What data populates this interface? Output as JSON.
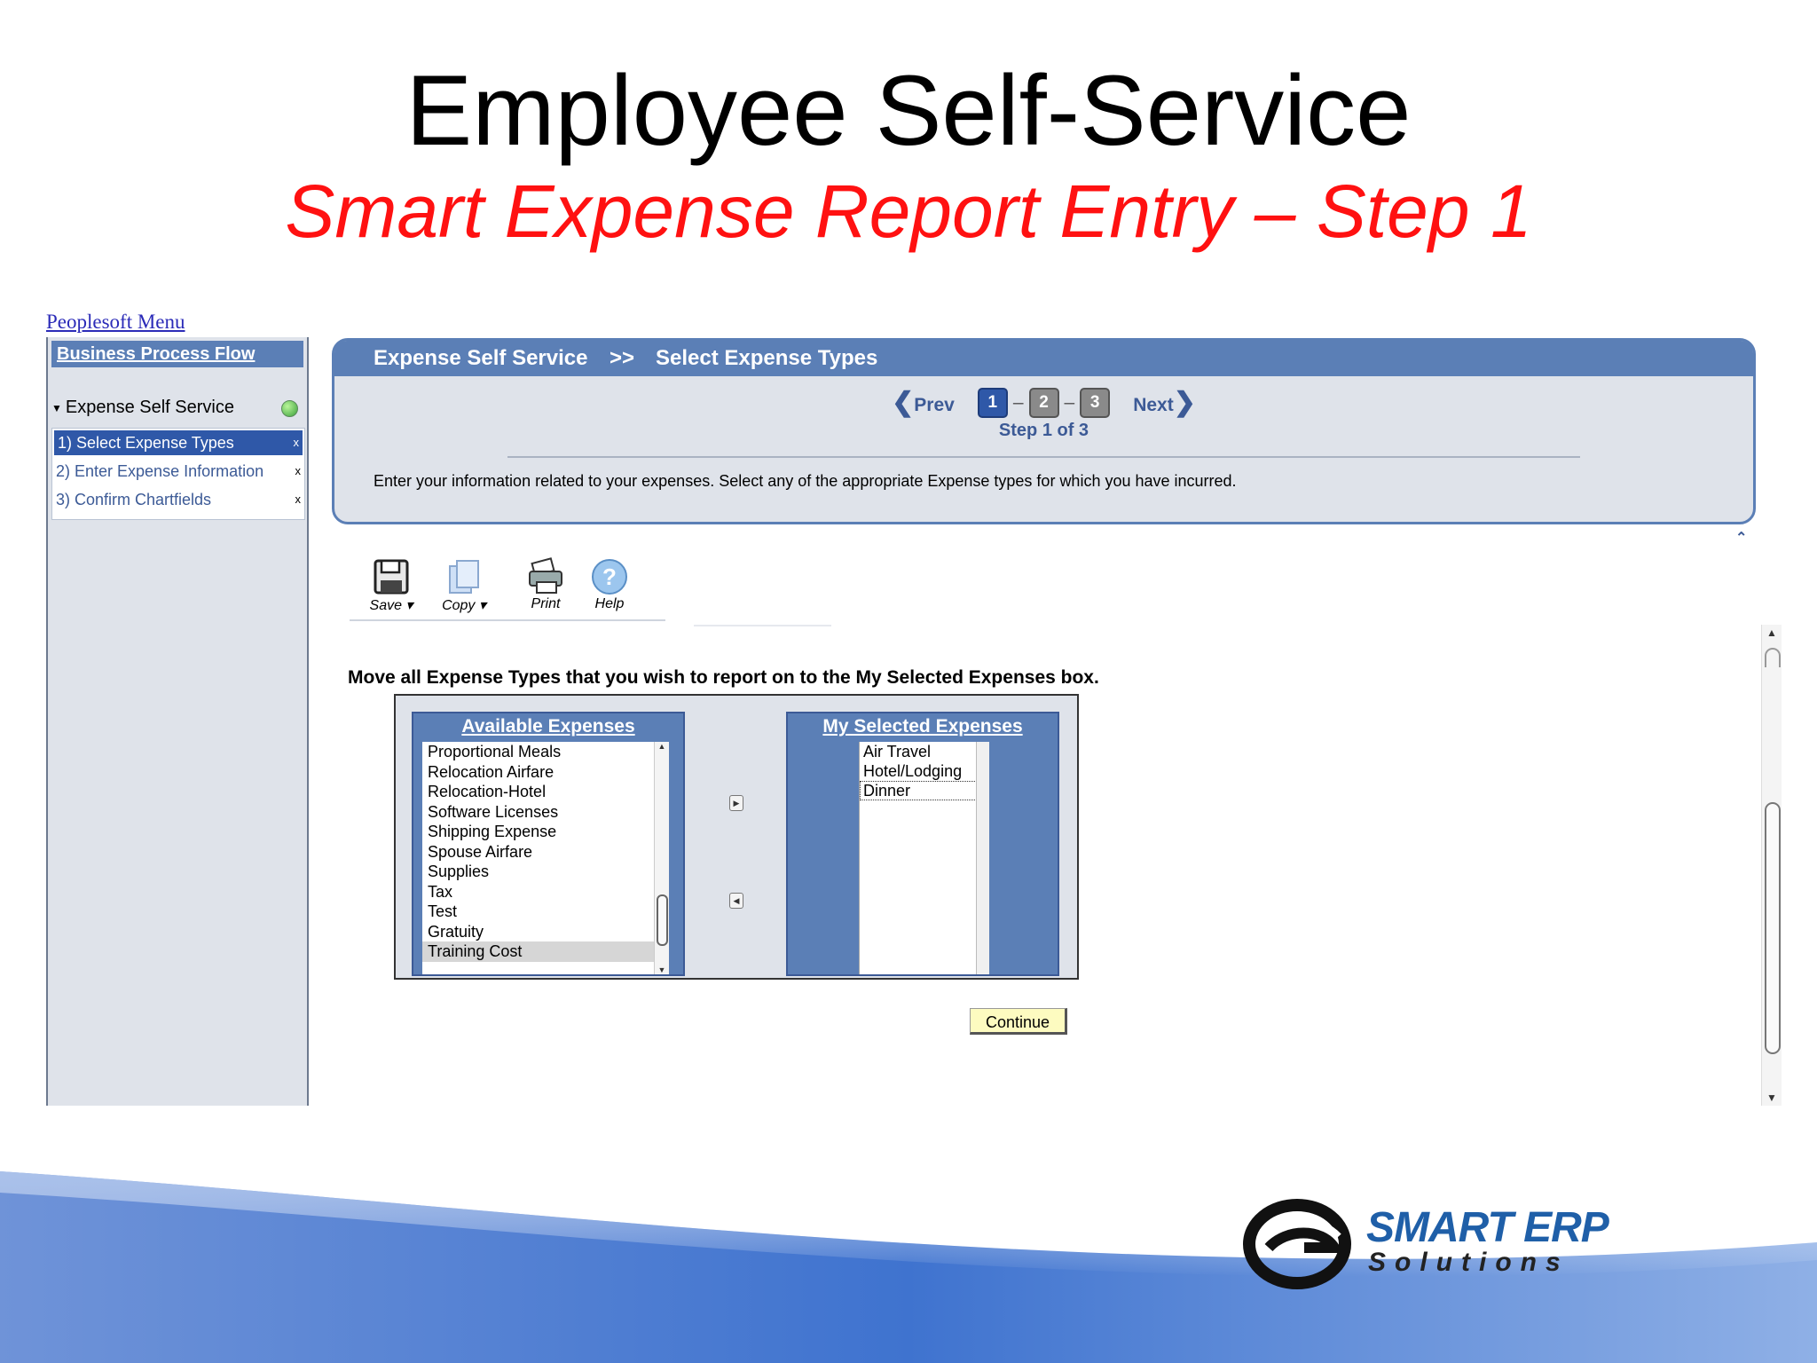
{
  "slide": {
    "title": "Employee Self-Service",
    "subtitle": "Smart Expense Report Entry – Step 1"
  },
  "leftnav": {
    "menu_link": "Peoplesoft Menu",
    "header": "Business Process Flow",
    "group_label": "Expense Self Service",
    "steps": [
      {
        "label": "1) Select Expense Types",
        "mark": "x"
      },
      {
        "label": "2) Enter Expense Information",
        "mark": "x"
      },
      {
        "label": "3) Confirm Chartfields",
        "mark": "x"
      }
    ]
  },
  "panel": {
    "crumb1": "Expense Self Service",
    "separator": ">>",
    "crumb2": "Select Expense Types",
    "prev": "Prev",
    "next": "Next",
    "step_numbers": [
      "1",
      "2",
      "3"
    ],
    "step_dash": "–",
    "step_of": "Step 1 of 3",
    "description": "Enter your information related to your expenses. Select any of the appropriate Expense types for which you have incurred."
  },
  "toolbar": {
    "save": "Save",
    "copy": "Copy",
    "print": "Print",
    "help": "Help"
  },
  "instruction": "Move all Expense Types that you wish to report on to the My Selected Expenses box.",
  "available": {
    "title": "Available Expenses",
    "items": [
      "Proportional Meals",
      "Relocation Airfare",
      "Relocation-Hotel",
      "Software Licenses",
      "Shipping Expense",
      "Spouse Airfare",
      "Supplies",
      "Tax",
      "Test",
      "Gratuity",
      "Training Cost"
    ],
    "selected_item": "Training Cost"
  },
  "selected": {
    "title": "My Selected Expenses",
    "items": [
      "Air Travel",
      "Hotel/Lodging",
      "Dinner"
    ]
  },
  "continue_label": "Continue",
  "logo": {
    "line1a": "SMART",
    "line1b": "ERP",
    "line2": "Solutions"
  },
  "colors": {
    "accent": "#5b7fb6",
    "subtitle": "#ff1111",
    "panel_bg": "#dfe3ea",
    "continue_bg": "#fdfbc0"
  }
}
